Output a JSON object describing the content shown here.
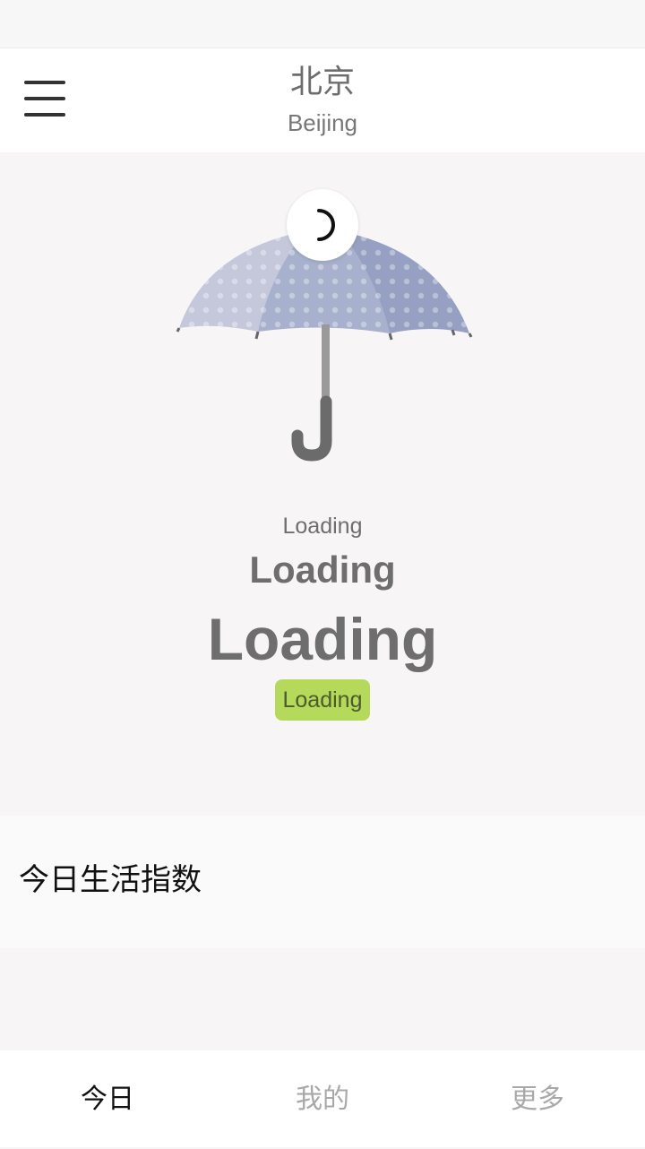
{
  "header": {
    "city_cn": "北京",
    "city_en": "Beijing",
    "menu_icon": "hamburger-menu-icon"
  },
  "hero": {
    "illustration": "umbrella-icon",
    "spinner": "loading-spinner-icon",
    "loading_small": "Loading",
    "loading_medium": "Loading",
    "loading_large": "Loading",
    "badge_label": "Loading",
    "badge_color": "#b5d95a"
  },
  "life_index": {
    "title": "今日生活指数"
  },
  "bottom_nav": {
    "tabs": [
      {
        "label": "今日",
        "active": true
      },
      {
        "label": "我的",
        "active": false
      },
      {
        "label": "更多",
        "active": false
      }
    ]
  }
}
